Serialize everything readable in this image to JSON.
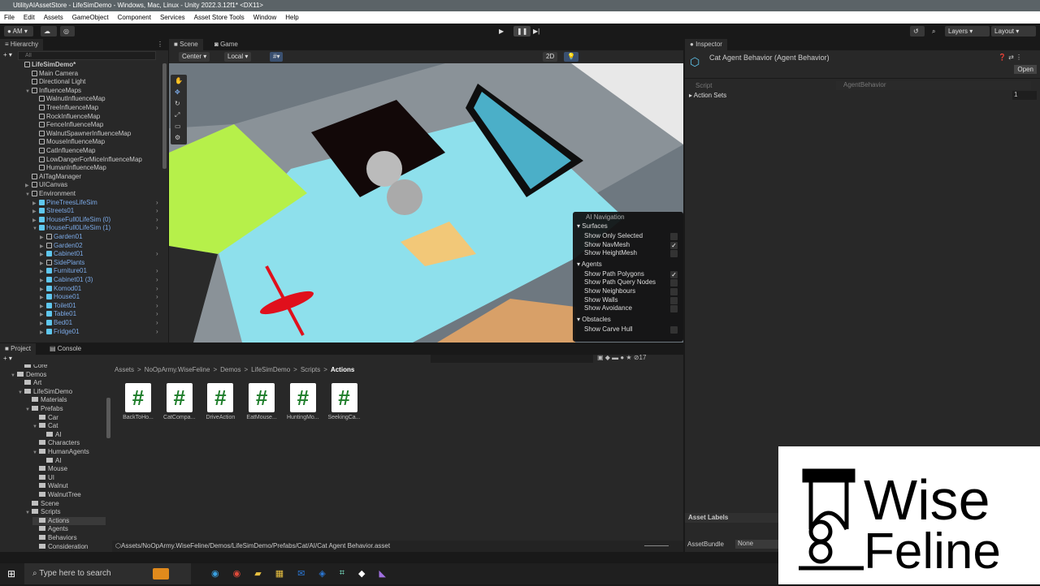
{
  "window": {
    "title": "UtilityAIAssetStore - LifeSimDemo - Windows, Mac, Linux - Unity 2022.3.12f1* <DX11>"
  },
  "menu": [
    "File",
    "Edit",
    "Assets",
    "GameObject",
    "Component",
    "Services",
    "Asset Store Tools",
    "Window",
    "Help"
  ],
  "toolbar": {
    "account": "AM",
    "layers": "Layers",
    "layout": "Layout"
  },
  "hierarchy": {
    "tab": "Hierarchy",
    "search_placeholder": "All",
    "items": [
      {
        "label": "LifeSimDemo*",
        "depth": 0,
        "bold": true
      },
      {
        "label": "Main Camera",
        "depth": 1
      },
      {
        "label": "Directional Light",
        "depth": 1
      },
      {
        "label": "InfluenceMaps",
        "depth": 1,
        "arrow": "down"
      },
      {
        "label": "WalnutInfluenceMap",
        "depth": 2
      },
      {
        "label": "TreeInfluenceMap",
        "depth": 2
      },
      {
        "label": "RockInfluenceMap",
        "depth": 2
      },
      {
        "label": "FenceInfluenceMap",
        "depth": 2
      },
      {
        "label": "WalnutSpawnerInfluenceMap",
        "depth": 2
      },
      {
        "label": "MouseInfluenceMap",
        "depth": 2
      },
      {
        "label": "CatInfluenceMap",
        "depth": 2
      },
      {
        "label": "LowDangerForMiceInfluenceMap",
        "depth": 2
      },
      {
        "label": "HumanInfluenceMap",
        "depth": 2
      },
      {
        "label": "AITagManager",
        "depth": 1
      },
      {
        "label": "UICanvas",
        "depth": 1,
        "arrow": "right"
      },
      {
        "label": "Environment",
        "depth": 1,
        "arrow": "down"
      },
      {
        "label": "PineTreesLifeSim",
        "depth": 2,
        "prefab": true,
        "arrow": "right"
      },
      {
        "label": "Streets01",
        "depth": 2,
        "prefab": true,
        "arrow": "right"
      },
      {
        "label": "HouseFull0LifeSim (0)",
        "depth": 2,
        "prefab": true,
        "arrow": "right"
      },
      {
        "label": "HouseFull0LifeSim (1)",
        "depth": 2,
        "prefab": true,
        "arrow": "down"
      },
      {
        "label": "Garden01",
        "depth": 3,
        "prefab": false,
        "blue": true,
        "arrow": "right"
      },
      {
        "label": "Garden02",
        "depth": 3,
        "prefab": false,
        "blue": true,
        "arrow": "right"
      },
      {
        "label": "Cabinet01",
        "depth": 3,
        "prefab": true,
        "arrow": "right"
      },
      {
        "label": "SidePlants",
        "depth": 3,
        "prefab": false,
        "blue": true,
        "arrow": "right"
      },
      {
        "label": "Furniture01",
        "depth": 3,
        "prefab": true,
        "arrow": "right"
      },
      {
        "label": "Cabinet01 (3)",
        "depth": 3,
        "prefab": true,
        "arrow": "right"
      },
      {
        "label": "Komod01",
        "depth": 3,
        "prefab": true,
        "arrow": "right"
      },
      {
        "label": "House01",
        "depth": 3,
        "prefab": true,
        "arrow": "right"
      },
      {
        "label": "Toilet01",
        "depth": 3,
        "prefab": true,
        "arrow": "right"
      },
      {
        "label": "Table01",
        "depth": 3,
        "prefab": true,
        "arrow": "right"
      },
      {
        "label": "Bed01",
        "depth": 3,
        "prefab": true,
        "arrow": "right"
      },
      {
        "label": "Fridge01",
        "depth": 3,
        "prefab": true,
        "arrow": "right"
      }
    ]
  },
  "scene": {
    "tabs": [
      "Scene",
      "Game"
    ],
    "pivot": "Center",
    "space": "Local",
    "mode_2d": "2D",
    "ai_navigation": {
      "title": "AI Navigation",
      "sections": [
        {
          "label": "Surfaces",
          "items": [
            {
              "label": "Show Only Selected",
              "checked": false
            },
            {
              "label": "Show NavMesh",
              "checked": true
            },
            {
              "label": "Show HeightMesh",
              "checked": false
            }
          ]
        },
        {
          "label": "Agents",
          "items": [
            {
              "label": "Show Path Polygons",
              "checked": true
            },
            {
              "label": "Show Path Query Nodes",
              "checked": false
            },
            {
              "label": "Show Neighbours",
              "checked": false
            },
            {
              "label": "Show Walls",
              "checked": false
            },
            {
              "label": "Show Avoidance",
              "checked": false
            }
          ]
        },
        {
          "label": "Obstacles",
          "items": [
            {
              "label": "Show Carve Hull",
              "checked": false
            }
          ]
        }
      ]
    }
  },
  "inspector": {
    "tab": "Inspector",
    "title": "Cat Agent Behavior (Agent Behavior)",
    "open_button": "Open",
    "script_label": "Script",
    "script_value": "AgentBehavior",
    "action_sets_label": "Action Sets",
    "action_sets_value": "1",
    "asset_labels": "Asset Labels",
    "assetbundle_label": "AssetBundle",
    "assetbundle_value": "None"
  },
  "project": {
    "tabs": [
      "Project",
      "Console"
    ],
    "hidden_count": "17",
    "breadcrumb": [
      "Assets",
      "NoOpArmy.WiseFeline",
      "Demos",
      "LifeSimDemo",
      "Scripts",
      "Actions"
    ],
    "tree": [
      {
        "label": "Core",
        "depth": 2
      },
      {
        "label": "Demos",
        "depth": 1,
        "open": true
      },
      {
        "label": "Art",
        "depth": 2
      },
      {
        "label": "LifeSimDemo",
        "depth": 2,
        "open": true
      },
      {
        "label": "Materials",
        "depth": 3
      },
      {
        "label": "Prefabs",
        "depth": 3,
        "open": true
      },
      {
        "label": "Car",
        "depth": 4
      },
      {
        "label": "Cat",
        "depth": 4,
        "open": true
      },
      {
        "label": "AI",
        "depth": 5
      },
      {
        "label": "Characters",
        "depth": 4
      },
      {
        "label": "HumanAgents",
        "depth": 4,
        "open": true
      },
      {
        "label": "AI",
        "depth": 5
      },
      {
        "label": "Mouse",
        "depth": 4
      },
      {
        "label": "UI",
        "depth": 4
      },
      {
        "label": "Walnut",
        "depth": 4
      },
      {
        "label": "WalnutTree",
        "depth": 4
      },
      {
        "label": "Scene",
        "depth": 3
      },
      {
        "label": "Scripts",
        "depth": 3,
        "open": true
      },
      {
        "label": "Actions",
        "depth": 4,
        "selected": true
      },
      {
        "label": "Agents",
        "depth": 4
      },
      {
        "label": "Behaviors",
        "depth": 4
      },
      {
        "label": "Consideration",
        "depth": 4
      }
    ],
    "assets": [
      "BackToHo...",
      "CatCompa...",
      "DriveAction",
      "EatMouse...",
      "HuntingMo...",
      "SeekingCa..."
    ],
    "status_path": "Assets/NoOpArmy.WiseFeline/Demos/LifeSimDemo/Prefabs/Cat/AI/Cat Agent Behavior.asset"
  },
  "taskbar": {
    "search_placeholder": "Type here to search"
  },
  "logo": {
    "text": "Wise Feline"
  },
  "colors": {
    "accent": "#7ba9e6",
    "script_icon": "#1e7d2a"
  }
}
